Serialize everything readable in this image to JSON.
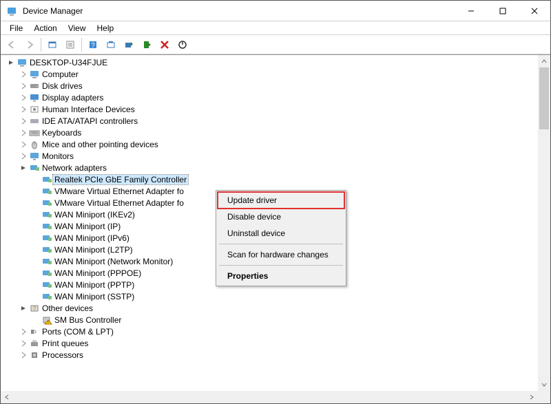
{
  "title": "Device Manager",
  "menus": [
    "File",
    "Action",
    "View",
    "Help"
  ],
  "root": "DESKTOP-U34FJUE",
  "categories": [
    {
      "name": "Computer",
      "exp": "closed",
      "icon": "computer"
    },
    {
      "name": "Disk drives",
      "exp": "closed",
      "icon": "disk"
    },
    {
      "name": "Display adapters",
      "exp": "closed",
      "icon": "display"
    },
    {
      "name": "Human Interface Devices",
      "exp": "closed",
      "icon": "hid"
    },
    {
      "name": "IDE ATA/ATAPI controllers",
      "exp": "closed",
      "icon": "ide"
    },
    {
      "name": "Keyboards",
      "exp": "closed",
      "icon": "keyboard"
    },
    {
      "name": "Mice and other pointing devices",
      "exp": "closed",
      "icon": "mouse"
    },
    {
      "name": "Monitors",
      "exp": "closed",
      "icon": "monitor"
    },
    {
      "name": "Network adapters",
      "exp": "open",
      "icon": "network",
      "children": [
        {
          "name": "Realtek PCIe GbE Family Controller",
          "selected": true
        },
        {
          "name": "VMware Virtual Ethernet Adapter fo"
        },
        {
          "name": "VMware Virtual Ethernet Adapter fo"
        },
        {
          "name": "WAN Miniport (IKEv2)"
        },
        {
          "name": "WAN Miniport (IP)"
        },
        {
          "name": "WAN Miniport (IPv6)"
        },
        {
          "name": "WAN Miniport (L2TP)"
        },
        {
          "name": "WAN Miniport (Network Monitor)"
        },
        {
          "name": "WAN Miniport (PPPOE)"
        },
        {
          "name": "WAN Miniport (PPTP)"
        },
        {
          "name": "WAN Miniport (SSTP)"
        }
      ]
    },
    {
      "name": "Other devices",
      "exp": "open",
      "icon": "other",
      "children": [
        {
          "name": "SM Bus Controller",
          "warn": true
        }
      ]
    },
    {
      "name": "Ports (COM & LPT)",
      "exp": "closed",
      "icon": "port"
    },
    {
      "name": "Print queues",
      "exp": "closed",
      "icon": "printer"
    },
    {
      "name": "Processors",
      "exp": "closed",
      "icon": "cpu"
    }
  ],
  "context": {
    "items": [
      {
        "label": "Update driver",
        "hl": true
      },
      {
        "label": "Disable device"
      },
      {
        "label": "Uninstall device"
      },
      {
        "sep": true
      },
      {
        "label": "Scan for hardware changes"
      },
      {
        "sep": true
      },
      {
        "label": "Properties",
        "bold": true
      }
    ]
  }
}
